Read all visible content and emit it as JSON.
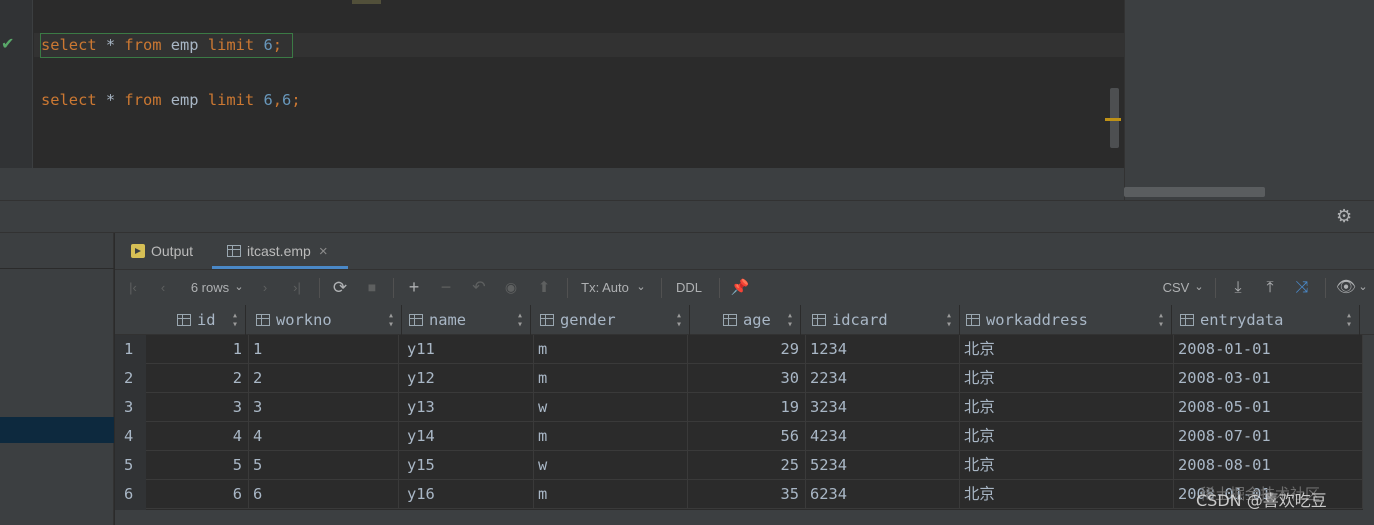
{
  "editor": {
    "line1": {
      "k1": "select",
      "op": " * ",
      "k2": "from",
      "tbl": " emp ",
      "k3": "limit",
      "sp": " ",
      "n1": "6",
      "end": ";"
    },
    "line2": {
      "k1": "select",
      "op": " * ",
      "k2": "from",
      "tbl": " emp ",
      "k3": "limit",
      "sp": " ",
      "n1": "6",
      "comma": ",",
      "n2": "6",
      "end": ";"
    },
    "status_icon": "check-icon"
  },
  "tabs": [
    {
      "label": "Output",
      "icon": "output-icon"
    },
    {
      "label": "itcast.emp",
      "icon": "table-icon",
      "close": "×"
    }
  ],
  "toolbar": {
    "rows_label": "6 rows",
    "tx_label": "Tx: Auto",
    "ddl_label": "DDL",
    "csv_label": "CSV",
    "first_page": "|‹",
    "prev_page": "‹",
    "next_page": "›",
    "last_page": "›|",
    "caret": "⌄"
  },
  "grid": {
    "columns": [
      "id",
      "workno",
      "name",
      "gender",
      "age",
      "idcard",
      "workaddress",
      "entrydata"
    ],
    "rows": [
      {
        "n": "1",
        "id": "1",
        "workno": "1",
        "name": "y11",
        "gender": "m",
        "age": "29",
        "idcard": "1234",
        "workaddress": "北京",
        "entrydata": "2008-01-01"
      },
      {
        "n": "2",
        "id": "2",
        "workno": "2",
        "name": "y12",
        "gender": "m",
        "age": "30",
        "idcard": "2234",
        "workaddress": "北京",
        "entrydata": "2008-03-01"
      },
      {
        "n": "3",
        "id": "3",
        "workno": "3",
        "name": "y13",
        "gender": "w",
        "age": "19",
        "idcard": "3234",
        "workaddress": "北京",
        "entrydata": "2008-05-01"
      },
      {
        "n": "4",
        "id": "4",
        "workno": "4",
        "name": "y14",
        "gender": "m",
        "age": "56",
        "idcard": "4234",
        "workaddress": "北京",
        "entrydata": "2008-07-01"
      },
      {
        "n": "5",
        "id": "5",
        "workno": "5",
        "name": "y15",
        "gender": "w",
        "age": "25",
        "idcard": "5234",
        "workaddress": "北京",
        "entrydata": "2008-08-01"
      },
      {
        "n": "6",
        "id": "6",
        "workno": "6",
        "name": "y16",
        "gender": "m",
        "age": "35",
        "idcard": "6234",
        "workaddress": "北京",
        "entrydata": "2008-01-01"
      }
    ]
  },
  "watermark": {
    "text": "CSDN @喜欢吃豆",
    "text2": "稀土掘金技术社区"
  },
  "colors": {
    "keyword": "#cc7832",
    "number": "#6897bb",
    "accent": "#4a88c7",
    "check": "#59a869"
  }
}
